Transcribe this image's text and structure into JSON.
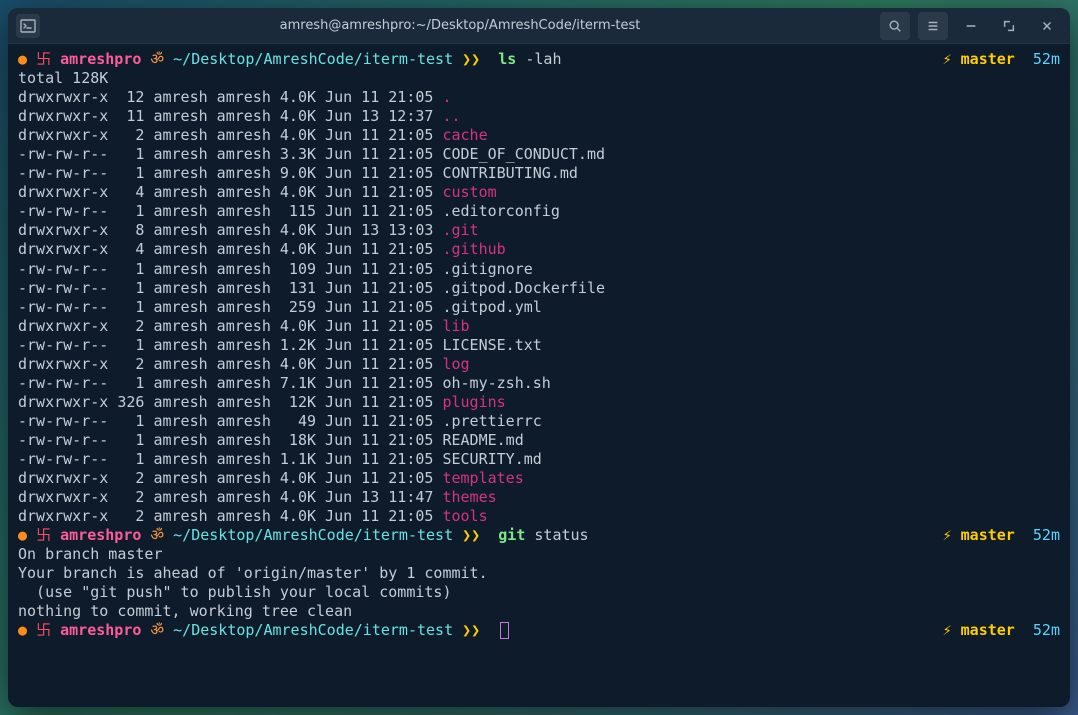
{
  "title": "amresh@amreshpro:~/Desktop/AmreshCode/iterm-test",
  "prompt": {
    "dot": "●",
    "swastik": "卐",
    "user": "amreshpro",
    "om": "ॐ",
    "path": "~/Desktop/AmreshCode/iterm-test",
    "arrows": "❯❯",
    "bolt": "⚡",
    "branch": "master",
    "time": "52m"
  },
  "cmd1": {
    "exe": "ls",
    "args": "-lah"
  },
  "cmd2": {
    "exe": "git",
    "args": "status"
  },
  "ls_total": "total 128K",
  "ls": [
    {
      "perm": "drwxrwxr-x",
      "n": " 12",
      "u": "amresh",
      "g": "amresh",
      "sz": "4.0K",
      "date": "Jun 11 21:05",
      "name": ".",
      "dir": true
    },
    {
      "perm": "drwxrwxr-x",
      "n": " 11",
      "u": "amresh",
      "g": "amresh",
      "sz": "4.0K",
      "date": "Jun 13 12:37",
      "name": "..",
      "dir": true
    },
    {
      "perm": "drwxrwxr-x",
      "n": "  2",
      "u": "amresh",
      "g": "amresh",
      "sz": "4.0K",
      "date": "Jun 11 21:05",
      "name": "cache",
      "dir": true
    },
    {
      "perm": "-rw-rw-r--",
      "n": "  1",
      "u": "amresh",
      "g": "amresh",
      "sz": "3.3K",
      "date": "Jun 11 21:05",
      "name": "CODE_OF_CONDUCT.md",
      "dir": false
    },
    {
      "perm": "-rw-rw-r--",
      "n": "  1",
      "u": "amresh",
      "g": "amresh",
      "sz": "9.0K",
      "date": "Jun 11 21:05",
      "name": "CONTRIBUTING.md",
      "dir": false
    },
    {
      "perm": "drwxrwxr-x",
      "n": "  4",
      "u": "amresh",
      "g": "amresh",
      "sz": "4.0K",
      "date": "Jun 11 21:05",
      "name": "custom",
      "dir": true
    },
    {
      "perm": "-rw-rw-r--",
      "n": "  1",
      "u": "amresh",
      "g": "amresh",
      "sz": " 115",
      "date": "Jun 11 21:05",
      "name": ".editorconfig",
      "dir": false
    },
    {
      "perm": "drwxrwxr-x",
      "n": "  8",
      "u": "amresh",
      "g": "amresh",
      "sz": "4.0K",
      "date": "Jun 13 13:03",
      "name": ".git",
      "dir": true
    },
    {
      "perm": "drwxrwxr-x",
      "n": "  4",
      "u": "amresh",
      "g": "amresh",
      "sz": "4.0K",
      "date": "Jun 11 21:05",
      "name": ".github",
      "dir": true
    },
    {
      "perm": "-rw-rw-r--",
      "n": "  1",
      "u": "amresh",
      "g": "amresh",
      "sz": " 109",
      "date": "Jun 11 21:05",
      "name": ".gitignore",
      "dir": false
    },
    {
      "perm": "-rw-rw-r--",
      "n": "  1",
      "u": "amresh",
      "g": "amresh",
      "sz": " 131",
      "date": "Jun 11 21:05",
      "name": ".gitpod.Dockerfile",
      "dir": false
    },
    {
      "perm": "-rw-rw-r--",
      "n": "  1",
      "u": "amresh",
      "g": "amresh",
      "sz": " 259",
      "date": "Jun 11 21:05",
      "name": ".gitpod.yml",
      "dir": false
    },
    {
      "perm": "drwxrwxr-x",
      "n": "  2",
      "u": "amresh",
      "g": "amresh",
      "sz": "4.0K",
      "date": "Jun 11 21:05",
      "name": "lib",
      "dir": true
    },
    {
      "perm": "-rw-rw-r--",
      "n": "  1",
      "u": "amresh",
      "g": "amresh",
      "sz": "1.2K",
      "date": "Jun 11 21:05",
      "name": "LICENSE.txt",
      "dir": false
    },
    {
      "perm": "drwxrwxr-x",
      "n": "  2",
      "u": "amresh",
      "g": "amresh",
      "sz": "4.0K",
      "date": "Jun 11 21:05",
      "name": "log",
      "dir": true
    },
    {
      "perm": "-rw-rw-r--",
      "n": "  1",
      "u": "amresh",
      "g": "amresh",
      "sz": "7.1K",
      "date": "Jun 11 21:05",
      "name": "oh-my-zsh.sh",
      "dir": false
    },
    {
      "perm": "drwxrwxr-x",
      "n": "326",
      "u": "amresh",
      "g": "amresh",
      "sz": " 12K",
      "date": "Jun 11 21:05",
      "name": "plugins",
      "dir": true
    },
    {
      "perm": "-rw-rw-r--",
      "n": "  1",
      "u": "amresh",
      "g": "amresh",
      "sz": "  49",
      "date": "Jun 11 21:05",
      "name": ".prettierrc",
      "dir": false
    },
    {
      "perm": "-rw-rw-r--",
      "n": "  1",
      "u": "amresh",
      "g": "amresh",
      "sz": " 18K",
      "date": "Jun 11 21:05",
      "name": "README.md",
      "dir": false
    },
    {
      "perm": "-rw-rw-r--",
      "n": "  1",
      "u": "amresh",
      "g": "amresh",
      "sz": "1.1K",
      "date": "Jun 11 21:05",
      "name": "SECURITY.md",
      "dir": false
    },
    {
      "perm": "drwxrwxr-x",
      "n": "  2",
      "u": "amresh",
      "g": "amresh",
      "sz": "4.0K",
      "date": "Jun 11 21:05",
      "name": "templates",
      "dir": true
    },
    {
      "perm": "drwxrwxr-x",
      "n": "  2",
      "u": "amresh",
      "g": "amresh",
      "sz": "4.0K",
      "date": "Jun 13 11:47",
      "name": "themes",
      "dir": true
    },
    {
      "perm": "drwxrwxr-x",
      "n": "  2",
      "u": "amresh",
      "g": "amresh",
      "sz": "4.0K",
      "date": "Jun 11 21:05",
      "name": "tools",
      "dir": true
    }
  ],
  "git_status": [
    "On branch master",
    "Your branch is ahead of 'origin/master' by 1 commit.",
    "  (use \"git push\" to publish your local commits)",
    "",
    "nothing to commit, working tree clean"
  ]
}
